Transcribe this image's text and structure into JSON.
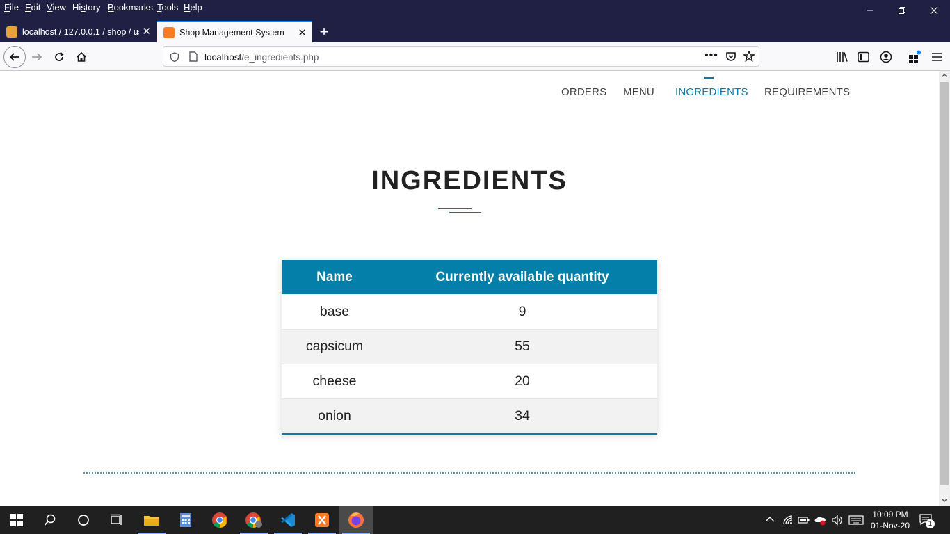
{
  "menubar": {
    "items": [
      "File",
      "Edit",
      "View",
      "History",
      "Bookmarks",
      "Tools",
      "Help"
    ],
    "accel": [
      "F",
      "E",
      "V",
      "s",
      "B",
      "T",
      "H"
    ]
  },
  "tabs": [
    {
      "title": "localhost / 127.0.0.1 / shop / us",
      "icon": "phpmyadmin-icon"
    },
    {
      "title": "Shop Management System",
      "icon": "xampp-icon"
    }
  ],
  "url": {
    "host": "localhost",
    "path": "/e_ingredients.php"
  },
  "nav": {
    "links": [
      "ORDERS",
      "MENU",
      "INGREDIENTS",
      "REQUIREMENTS"
    ],
    "active": "INGREDIENTS"
  },
  "page": {
    "title": "INGREDIENTS"
  },
  "table": {
    "headers": [
      "Name",
      "Currently available quantity"
    ],
    "rows": [
      [
        "base",
        "9"
      ],
      [
        "capsicum",
        "55"
      ],
      [
        "cheese",
        "20"
      ],
      [
        "onion",
        "34"
      ]
    ]
  },
  "taskbar": {
    "time": "10:09 PM",
    "date": "01-Nov-20",
    "notifications": "1"
  },
  "colors": {
    "accent": "#037fa9",
    "chrome": "#1f2044",
    "taskbar": "#202020"
  }
}
